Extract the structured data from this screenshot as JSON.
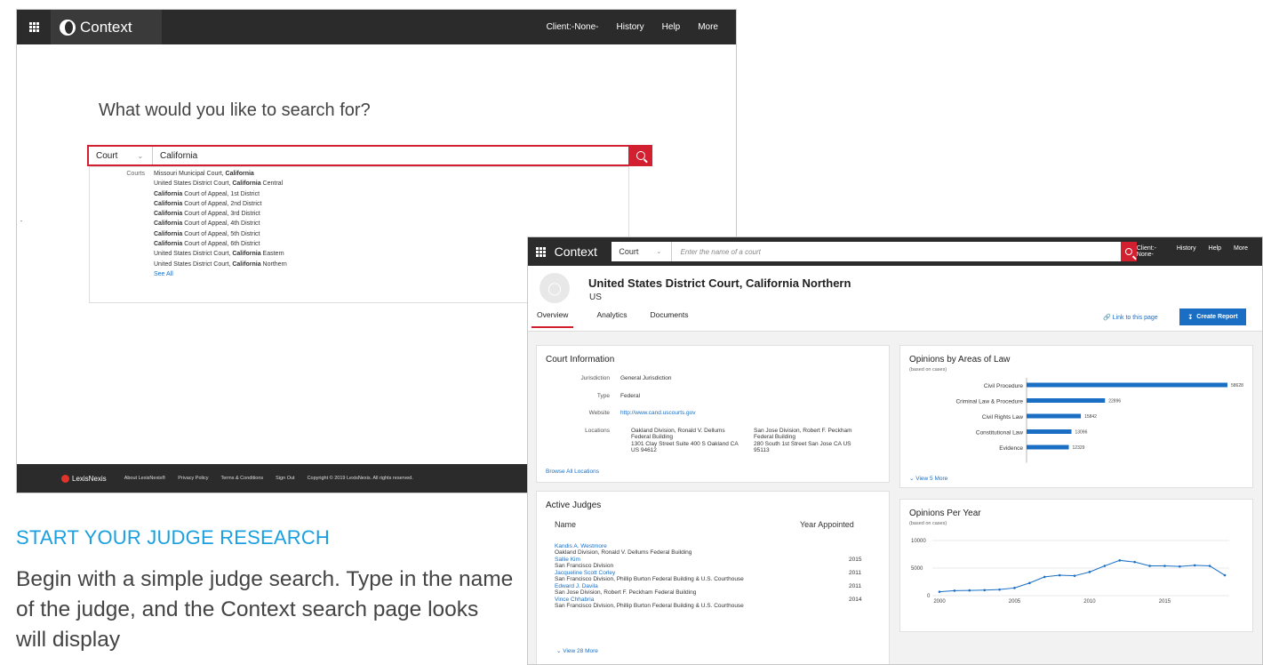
{
  "screen1": {
    "brand": "Context",
    "nav": [
      "Client:-None-",
      "History",
      "Help",
      "More"
    ],
    "question": "What would you like to search for?",
    "search": {
      "type": "Court",
      "value": "California"
    },
    "dropdown": {
      "category": "Courts",
      "items": [
        {
          "pre": "Missouri Municipal Court, ",
          "bold": "California",
          "post": ""
        },
        {
          "pre": "United States District Court, ",
          "bold": "California",
          "post": " Central"
        },
        {
          "pre": "",
          "bold": "California",
          "post": " Court of Appeal, 1st District"
        },
        {
          "pre": "",
          "bold": "California",
          "post": " Court of Appeal, 2nd District"
        },
        {
          "pre": "",
          "bold": "California",
          "post": " Court of Appeal, 3rd District"
        },
        {
          "pre": "",
          "bold": "California",
          "post": " Court of Appeal, 4th District"
        },
        {
          "pre": "",
          "bold": "California",
          "post": " Court of Appeal, 5th District"
        },
        {
          "pre": "",
          "bold": "California",
          "post": " Court of Appeal, 6th District"
        },
        {
          "pre": "United States District Court, ",
          "bold": "California",
          "post": " Eastern"
        },
        {
          "pre": "United States District Court, ",
          "bold": "California",
          "post": " Northern"
        }
      ],
      "see_all": "See All"
    },
    "footer": {
      "logo": "LexisNexis",
      "links": [
        "About LexisNexis®",
        "Privacy Policy",
        "Terms & Conditions",
        "Sign Out",
        "Copyright © 2019 LexisNexis. All rights reserved."
      ]
    }
  },
  "marketing": {
    "heading": "START YOUR JUDGE RESEARCH",
    "body": "Begin with a simple judge search. Type in the name of the judge, and the Context search page looks will display"
  },
  "screen2": {
    "brand": "Context",
    "search_type": "Court",
    "search_placeholder": "Enter the name of a court",
    "nav": [
      "Client:-None-",
      "History",
      "Help",
      "More"
    ],
    "court_title": "United States District Court, California Northern",
    "court_sub": "US",
    "tabs": [
      "Overview",
      "Analytics",
      "Documents"
    ],
    "link_page": "Link to this page",
    "create_report": "Create Report",
    "court_info": {
      "title": "Court Information",
      "jurisdiction_label": "Jurisdiction",
      "jurisdiction": "General Jurisdiction",
      "type_label": "Type",
      "type": "Federal",
      "website_label": "Website",
      "website": "http://www.cand.uscourts.gov",
      "locations_label": "Locations",
      "loc1": [
        "Oakland Division, Ronald V. Dellums",
        "Federal Building",
        "1301 Clay Street Suite 400 S Oakland CA",
        "US 94612"
      ],
      "loc2": [
        "San Jose Division, Robert F. Peckham",
        "Federal Building",
        "280 South 1st Street San Jose CA US",
        "95113"
      ],
      "browse": "Browse All Locations"
    },
    "judges": {
      "title": "Active Judges",
      "col_name": "Name",
      "col_year": "Year Appointed",
      "rows": [
        {
          "name": "Kandis A. Westmore",
          "div": "Oakland Division, Ronald V. Dellums Federal Building",
          "year": ""
        },
        {
          "name": "Sallie Kim",
          "div": "San Francisco Division",
          "year": "2015"
        },
        {
          "name": "Jacqueline Scott Corley",
          "div": "San Francisco Division, Phillip Burton Federal Building & U.S. Courthouse",
          "year": "2011"
        },
        {
          "name": "Edward J. Davila",
          "div": "San Jose Division, Robert F. Peckham Federal Building",
          "year": "2011"
        },
        {
          "name": "Vince Chhabria",
          "div": "San Francisco Division, Phillip Burton Federal Building & U.S. Courthouse",
          "year": "2014"
        }
      ],
      "more": "View 28 More"
    },
    "areas_of_law": {
      "title": "Opinions by Areas of Law",
      "subtitle": "(based on cases)",
      "more": "View 5 More"
    },
    "per_year": {
      "title": "Opinions Per Year",
      "subtitle": "(based on cases)"
    }
  },
  "chart_data": [
    {
      "type": "bar",
      "orientation": "horizontal",
      "title": "Opinions by Areas of Law",
      "subtitle": "(based on cases)",
      "categories": [
        "Civil Procedure",
        "Criminal Law & Procedure",
        "Civil Rights Law",
        "Constitutional Law",
        "Evidence"
      ],
      "values": [
        58628,
        22896,
        15842,
        13096,
        12329
      ],
      "color": "#1a6fc4"
    },
    {
      "type": "line",
      "title": "Opinions Per Year",
      "subtitle": "(based on cases)",
      "x": [
        2000,
        2001,
        2002,
        2003,
        2004,
        2005,
        2006,
        2007,
        2008,
        2009,
        2010,
        2011,
        2012,
        2013,
        2014,
        2015,
        2016,
        2017,
        2018,
        2019
      ],
      "y": [
        700,
        900,
        950,
        1000,
        1100,
        1400,
        2300,
        3400,
        3700,
        3600,
        4300,
        5400,
        6400,
        6100,
        5400,
        5400,
        5300,
        5500,
        5400,
        3700
      ],
      "xticks": [
        2000,
        2005,
        2010,
        2015
      ],
      "yticks": [
        0,
        5000,
        10000
      ],
      "ylim": [
        0,
        10000
      ],
      "grid": true,
      "color": "#1a6fc4"
    }
  ]
}
